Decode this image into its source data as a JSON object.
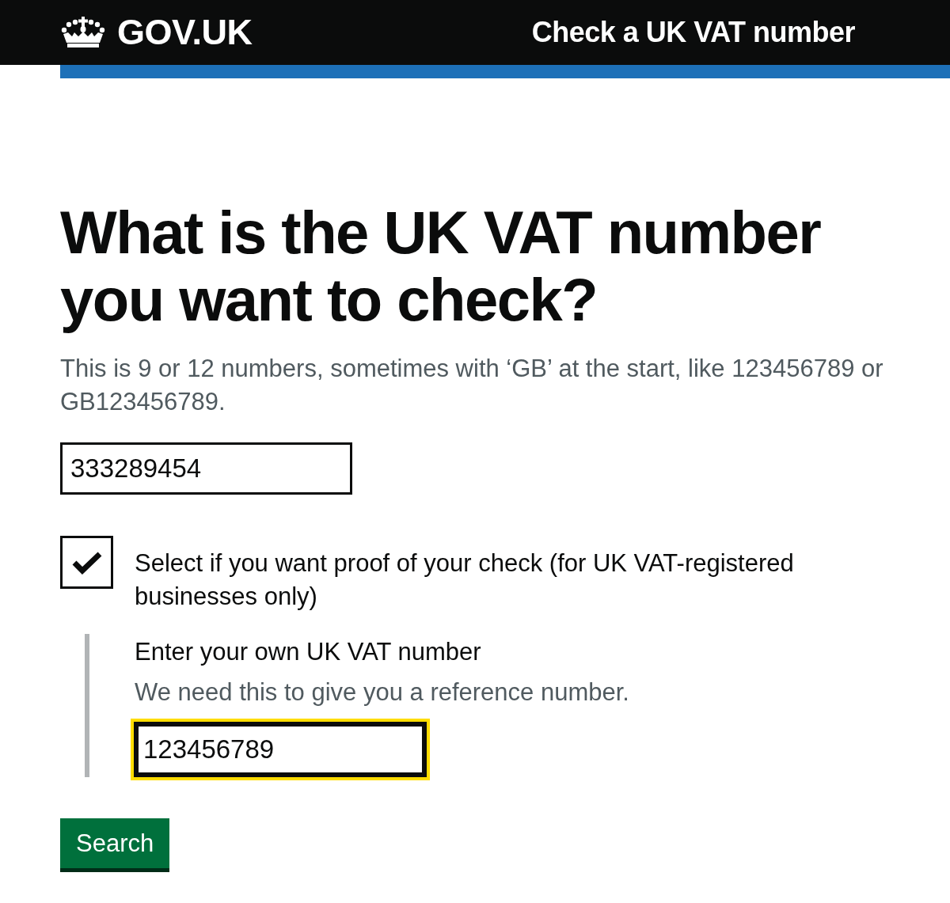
{
  "header": {
    "logo_text": "GOV.UK",
    "service_name": "Check a UK VAT number"
  },
  "heading": "What is the UK VAT number you want to check?",
  "hint": "This is 9 or 12 numbers, sometimes with ‘GB’ at the start, like 123456789 or GB123456789.",
  "vat_number_field": {
    "value": "333289454"
  },
  "proof_checkbox": {
    "label": "Select if you want proof of your check (for UK VAT-registered businesses only)",
    "checked": true,
    "conditional": {
      "label": "Enter your own UK VAT number",
      "hint": "We need this to give you a reference number.",
      "field": {
        "value": "123456789",
        "focused": true
      }
    }
  },
  "buttons": [
    {
      "label": "Search",
      "kind": "primary"
    }
  ]
}
